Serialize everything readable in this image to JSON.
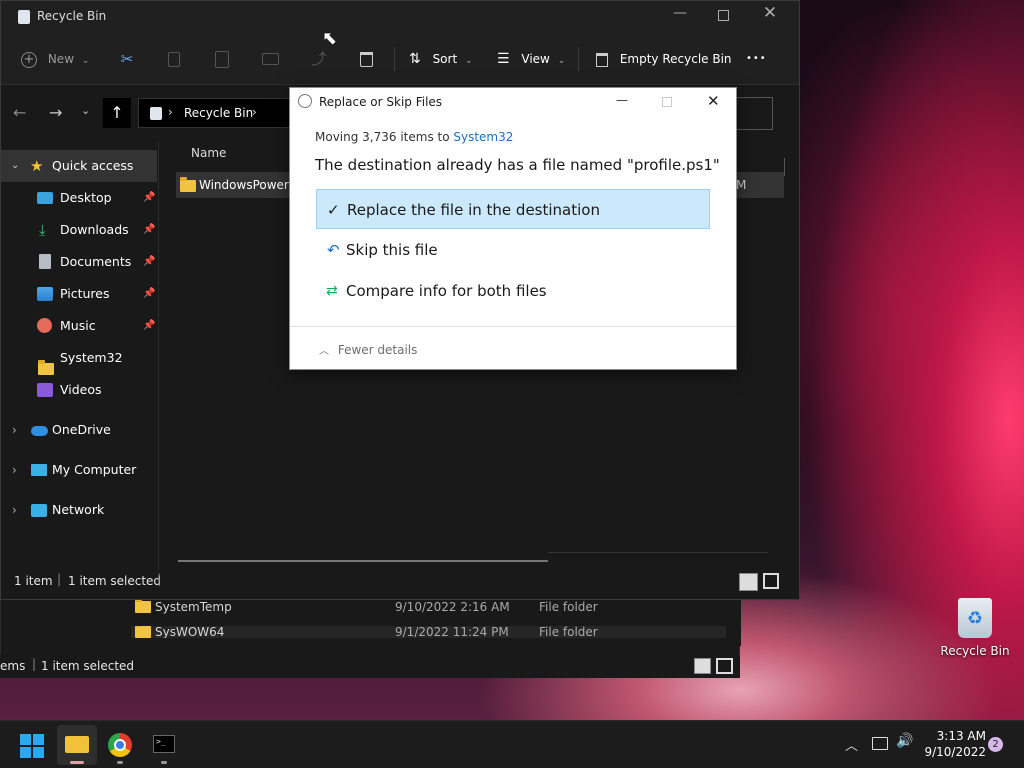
{
  "desktop": {
    "recycle_bin_label": "Recycle Bin"
  },
  "back_window": {
    "rows": [
      {
        "name": "SystemTemp",
        "date": "9/10/2022 2:16 AM",
        "type": "File folder"
      },
      {
        "name": "SysWOW64",
        "date": "9/1/2022 11:24 PM",
        "type": "File folder"
      }
    ],
    "status_items": "ems",
    "status_selected": "1 item selected"
  },
  "main_window": {
    "title": "Recycle Bin",
    "toolbar": {
      "new_label": "New",
      "sort_label": "Sort",
      "view_label": "View",
      "empty_label": "Empty Recycle Bin",
      "more_label": "•••"
    },
    "address": {
      "crumb": "Recycle Bin"
    },
    "nav": {
      "quick_access": "Quick access",
      "items": [
        {
          "label": "Desktop",
          "pinned": true
        },
        {
          "label": "Downloads",
          "pinned": true
        },
        {
          "label": "Documents",
          "pinned": true
        },
        {
          "label": "Pictures",
          "pinned": true
        },
        {
          "label": "Music",
          "pinned": true
        },
        {
          "label": "System32",
          "pinned": false
        },
        {
          "label": "Videos",
          "pinned": false
        }
      ],
      "onedrive": "OneDrive",
      "my_computer": "My Computer",
      "network": "Network"
    },
    "content": {
      "col_name": "Name",
      "row_name": "WindowsPowerSh",
      "row_tail": "M"
    },
    "status": {
      "items": "1 item",
      "selected": "1 item selected"
    }
  },
  "dialog": {
    "title": "Replace or Skip Files",
    "moving_prefix": "Moving 3,736 items to ",
    "moving_dest": "System32",
    "heading": "The destination already has a file named \"profile.ps1\"",
    "opt_replace": "Replace the file in the destination",
    "opt_skip": "Skip this file",
    "opt_compare": "Compare info for both files",
    "fewer_details": "Fewer details"
  },
  "taskbar": {
    "time": "3:13 AM",
    "date": "9/10/2022",
    "notification_count": "2"
  },
  "colors": {
    "accent": "#0078d4",
    "selected_option": "#cce8fb",
    "folder_yellow": "#f1c43f"
  }
}
